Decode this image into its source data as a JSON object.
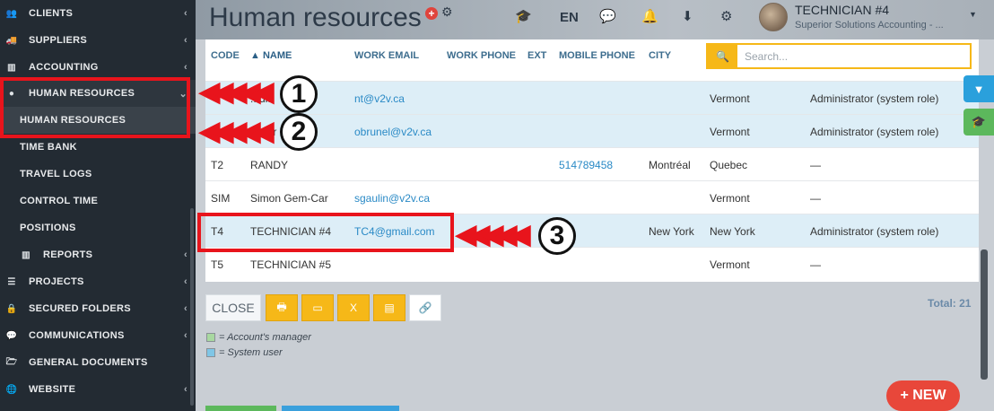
{
  "sidebar": {
    "items": [
      {
        "label": "CLIENTS",
        "icon": "users-icon",
        "glyph": "👥",
        "chev": "‹"
      },
      {
        "label": "SUPPLIERS",
        "icon": "truck-icon",
        "glyph": "🚚",
        "chev": "‹"
      },
      {
        "label": "ACCOUNTING",
        "icon": "chart-icon",
        "glyph": "▥",
        "chev": "‹"
      },
      {
        "label": "HUMAN RESOURCES",
        "icon": "user-icon",
        "glyph": "●",
        "chev": "⌄"
      },
      {
        "label": "HUMAN RESOURCES"
      },
      {
        "label": "TIME BANK"
      },
      {
        "label": "TRAVEL LOGS"
      },
      {
        "label": "CONTROL TIME"
      },
      {
        "label": "POSITIONS"
      },
      {
        "label": "REPORTS",
        "icon": "chart-icon",
        "glyph": "▥",
        "chev": "‹"
      },
      {
        "label": "PROJECTS",
        "icon": "list-icon",
        "glyph": "☰",
        "chev": "‹"
      },
      {
        "label": "SECURED FOLDERS",
        "icon": "lock-icon",
        "glyph": "🔒",
        "chev": "‹"
      },
      {
        "label": "COMMUNICATIONS",
        "icon": "comments-icon",
        "glyph": "💬",
        "chev": "‹"
      },
      {
        "label": "GENERAL DOCUMENTS",
        "icon": "folder-open-icon",
        "glyph": "🗁",
        "chev": ""
      },
      {
        "label": "WEBSITE",
        "icon": "globe-icon",
        "glyph": "🌐",
        "chev": "‹"
      }
    ]
  },
  "header": {
    "title": "Human resources",
    "lang": "EN",
    "user_name": "TECHNICIAN #4",
    "user_company": "Superior Solutions Accounting - ..."
  },
  "table": {
    "columns": {
      "code": "CODE",
      "name": "▲ NAME",
      "work_email": "WORK EMAIL",
      "work_phone": "WORK PHONE",
      "ext": "EXT",
      "mobile_phone": "MOBILE PHONE",
      "city": "CITY"
    },
    "search_placeholder": "Search...",
    "rows": [
      {
        "code": "",
        "name": "...dia",
        "email": "nt@v2v.ca",
        "mobile": "",
        "city": "",
        "province": "Vermont",
        "role": "Administrator (system role)"
      },
      {
        "code": "",
        "name": "...vier",
        "email": "obrunel@v2v.ca",
        "mobile": "",
        "city": "",
        "province": "Vermont",
        "role": "Administrator (system role)"
      },
      {
        "code": "T2",
        "name": "RANDY",
        "email": "",
        "mobile": "514789458",
        "city": "Montréal",
        "province": "Quebec",
        "role": "—"
      },
      {
        "code": "SIM",
        "name": "Simon Gem-Car",
        "email": "sgaulin@v2v.ca",
        "mobile": "",
        "city": "",
        "province": "Vermont",
        "role": "—"
      },
      {
        "code": "T4",
        "name": "TECHNICIAN #4",
        "email": "TC4@gmail.com",
        "mobile": "",
        "city": "New York",
        "province": "New York",
        "role": "Administrator (system role)"
      },
      {
        "code": "T5",
        "name": "TECHNICIAN #5",
        "email": "",
        "mobile": "",
        "city": "",
        "province": "Vermont",
        "role": "—"
      }
    ]
  },
  "actions": {
    "close_label": "CLOSE",
    "total": "Total: 21",
    "legend_manager": "= Account's manager",
    "legend_user": "= System user"
  },
  "colors": {
    "manager": "#a8d8a0",
    "system_user": "#7fc6e6",
    "accent": "#f6b818",
    "callout": "#e8141c"
  },
  "new_button": "+ NEW",
  "callouts": [
    "1",
    "2",
    "3"
  ]
}
